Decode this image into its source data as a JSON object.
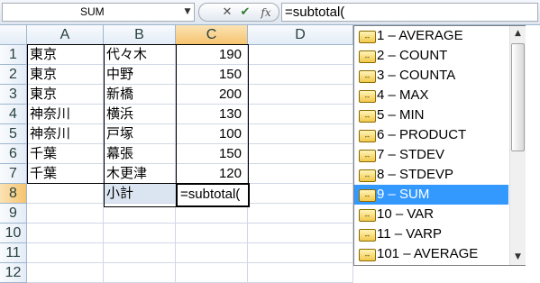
{
  "formula_bar": {
    "name_box": "SUM",
    "name_dropdown_icon": "▼",
    "cancel_icon": "✕",
    "enter_icon": "✔",
    "fx_label": "fx",
    "formula_text": "=subtotal("
  },
  "columns": [
    "A",
    "B",
    "C",
    "D"
  ],
  "rows": [
    "1",
    "2",
    "3",
    "4",
    "5",
    "6",
    "7",
    "8",
    "9",
    "10",
    "11",
    "12"
  ],
  "cells": {
    "r1": {
      "a": "東京",
      "b": "代々木",
      "c": "190"
    },
    "r2": {
      "a": "東京",
      "b": "中野",
      "c": "150"
    },
    "r3": {
      "a": "東京",
      "b": "新橋",
      "c": "200"
    },
    "r4": {
      "a": "神奈川",
      "b": "横浜",
      "c": "130"
    },
    "r5": {
      "a": "神奈川",
      "b": "戸塚",
      "c": "100"
    },
    "r6": {
      "a": "千葉",
      "b": "幕張",
      "c": "150"
    },
    "r7": {
      "a": "千葉",
      "b": "木更津",
      "c": "120"
    },
    "r8": {
      "b": "小計",
      "c": "=subtotal("
    }
  },
  "autocomplete": {
    "selected_index": 8,
    "items": [
      "1 – AVERAGE",
      "2 – COUNT",
      "3 – COUNTA",
      "4 – MAX",
      "5 – MIN",
      "6 – PRODUCT",
      "7 – STDEV",
      "8 – STDEVP",
      "9 – SUM",
      "10 – VAR",
      "11 – VARP",
      "101 – AVERAGE"
    ]
  },
  "colors": {
    "selected_item": "#3399ff",
    "header_selected": "#f6c46f",
    "grid_line": "#d0d7e5"
  }
}
